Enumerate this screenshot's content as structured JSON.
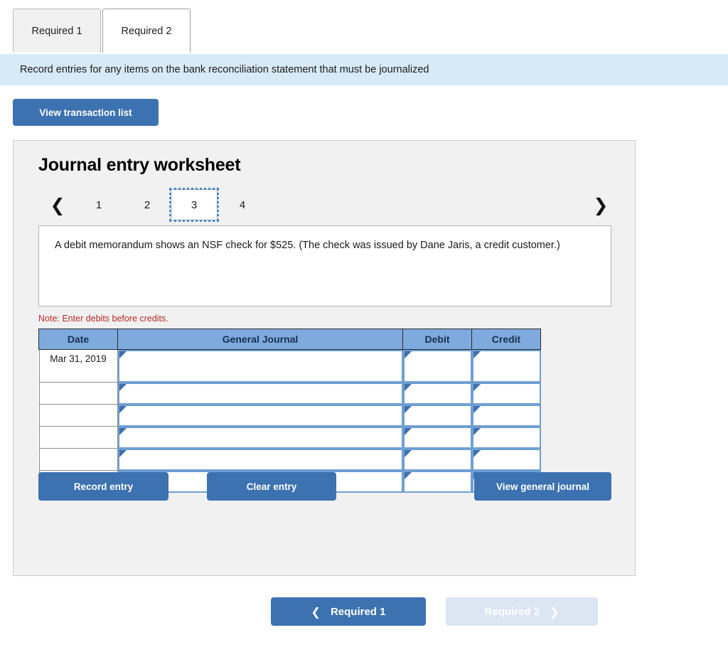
{
  "tabs": [
    {
      "label": "Required 1",
      "active": false
    },
    {
      "label": "Required 2",
      "active": true
    }
  ],
  "banner": {
    "text": "Record entries for any items on the bank reconciliation statement that must be journalized"
  },
  "toolbar": {
    "view_transaction_list": "View transaction list"
  },
  "worksheet": {
    "title": "Journal entry worksheet",
    "pager": {
      "prev_icon": "chevron-left-icon",
      "next_icon": "chevron-right-icon",
      "pages": [
        "1",
        "2",
        "3",
        "4"
      ],
      "current": "3"
    },
    "prompt": "A debit memorandum shows an NSF check for $525. (The check was issued by Dane Jaris, a credit customer.)",
    "note": "Note: Enter debits before credits.",
    "table": {
      "headers": [
        "Date",
        "General Journal",
        "Debit",
        "Credit"
      ],
      "rows": [
        {
          "date": "Mar 31, 2019",
          "general_journal": "",
          "debit": "",
          "credit": ""
        },
        {
          "date": "",
          "general_journal": "",
          "debit": "",
          "credit": ""
        },
        {
          "date": "",
          "general_journal": "",
          "debit": "",
          "credit": ""
        },
        {
          "date": "",
          "general_journal": "",
          "debit": "",
          "credit": ""
        },
        {
          "date": "",
          "general_journal": "",
          "debit": "",
          "credit": ""
        },
        {
          "date": "",
          "general_journal": "",
          "debit": "",
          "credit": ""
        }
      ]
    },
    "actions": {
      "record_entry": "Record entry",
      "clear_entry": "Clear entry",
      "view_general_journal": "View general journal"
    }
  },
  "footer": {
    "prev": {
      "label": "Required 1",
      "icon": "chevron-left-icon",
      "disabled": false
    },
    "next": {
      "label": "Required 2",
      "icon": "chevron-right-icon",
      "disabled": true
    }
  },
  "colors": {
    "accent_blue": "#3d72b0",
    "banner_blue": "#d7eaf7",
    "table_header_blue": "#7eaade",
    "note_red": "#b52b27",
    "panel_gray": "#f1f1f1"
  }
}
